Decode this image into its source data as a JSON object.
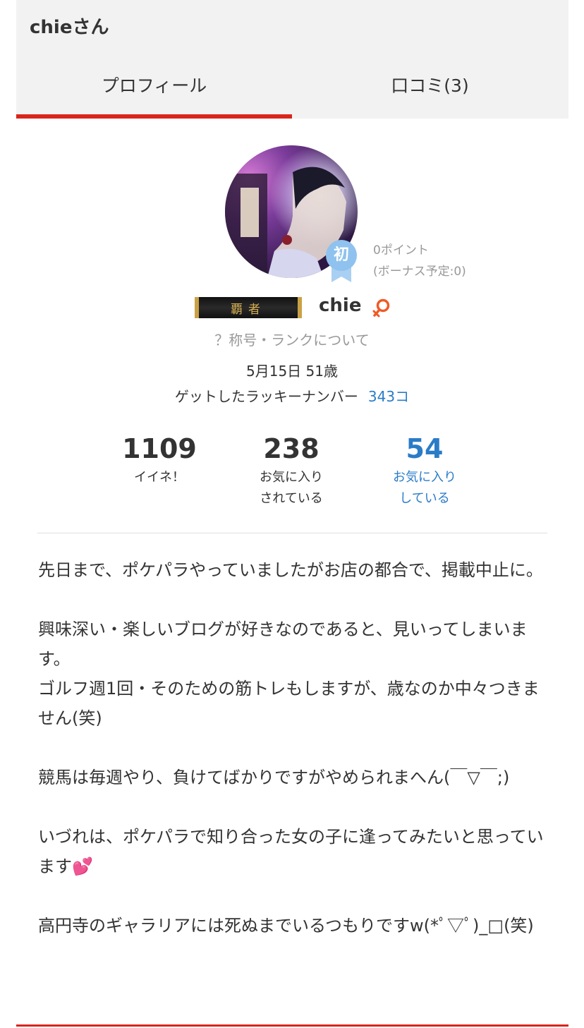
{
  "header": {
    "title": "chieさん",
    "tabs": [
      {
        "label": "プロフィール",
        "active": true
      },
      {
        "label": "口コミ(3)",
        "active": false
      }
    ]
  },
  "colors": {
    "accent_red": "#d9251d",
    "link_blue": "#2a7cc7",
    "gold": "#c9a245"
  },
  "profile": {
    "rank_badge_char": "初",
    "points": "0ポイント",
    "bonus": "(ボーナス予定:0)",
    "title_plate": "覇者",
    "username": "chie",
    "gender_icon": "female-icon",
    "rank_link": "？称号・ランクについて",
    "birthday": "5月15日 51歳",
    "lucky_label": "ゲットしたラッキーナンバー",
    "lucky_count": "343コ"
  },
  "stats": {
    "likes": {
      "value": "1109",
      "label": "イイネ！"
    },
    "favorited": {
      "value": "238",
      "label_1": "お気に入り",
      "label_2": "されている"
    },
    "favoriting": {
      "value": "54",
      "label_1": "お気に入り",
      "label_2": "している"
    }
  },
  "bio": {
    "p1": "先日まで、ポケパラやっていましたがお店の都合で、掲載中止に。",
    "p2": "興味深い・楽しいブログが好きなのであると、見いってしまいます。",
    "p3": "ゴルフ週1回・そのための筋トレもしますが、歳なのか中々つきません(笑)",
    "p4": "競馬は毎週やり、負けてばかりですがやめられまへん(￣▽￣;)",
    "p5": "いづれは、ポケパラで知り合った女の子に逢ってみたいと思っています💕",
    "p6": "高円寺のギャラリアには死ぬまでいるつもりですw(*ﾟ▽ﾟ)_□(笑)"
  }
}
